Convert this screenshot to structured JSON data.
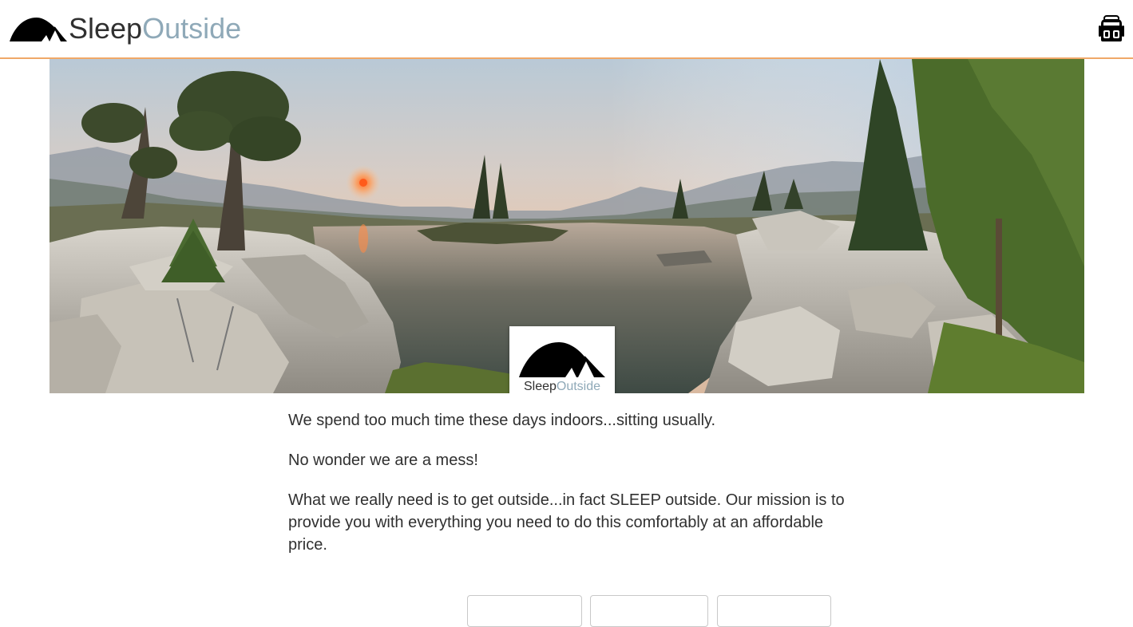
{
  "header": {
    "logo_sleep": "Sleep",
    "logo_outside": "Outside",
    "cart_icon": "backpack-icon"
  },
  "hero": {
    "image": "mountain-lake-sunset-panorama",
    "badge_sleep": "Sleep",
    "badge_outside": "Outside"
  },
  "mission": {
    "paragraph_1": "We spend too much time these days indoors...sitting usually.",
    "paragraph_2": "No wonder we are a mess!",
    "paragraph_3": "What we really need is to get outside...in fact SLEEP outside. Our mission is to provide you with everything you need to do this comfortably at an affordable price."
  },
  "product_buttons": [
    {
      "label": ""
    },
    {
      "label": ""
    },
    {
      "label": ""
    }
  ],
  "colors": {
    "accent_border": "#f0a868",
    "logo_outside": "#8fa9b8",
    "text": "#303030"
  }
}
